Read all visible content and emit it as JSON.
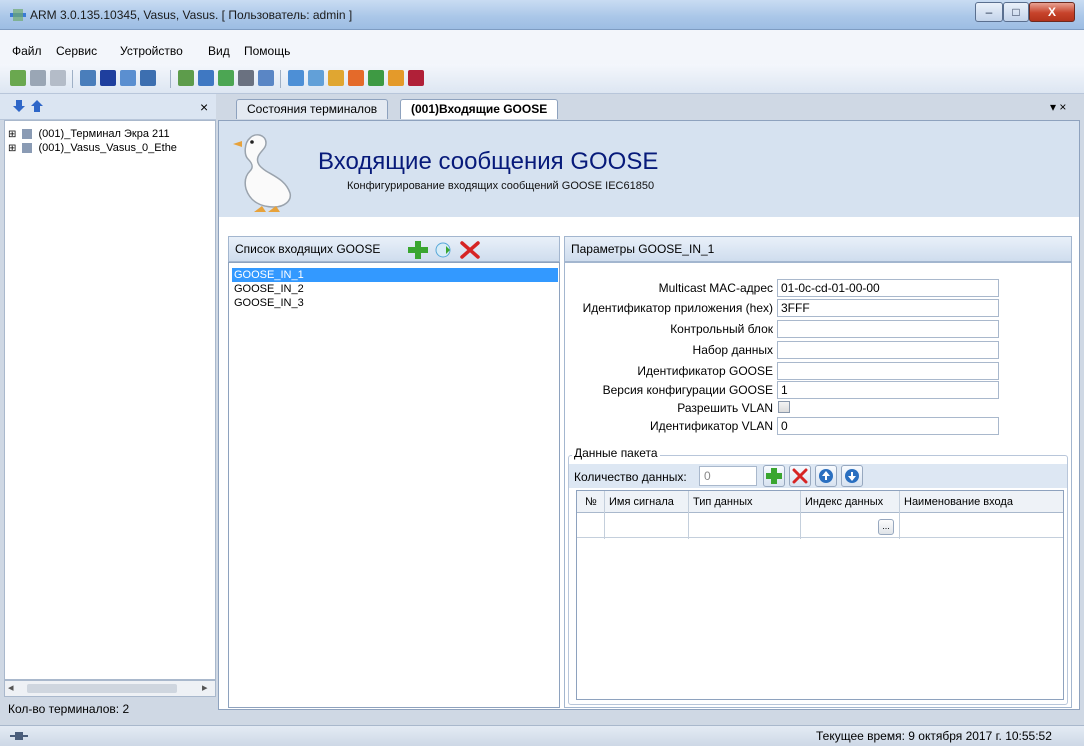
{
  "window": {
    "title": "ARM 3.0.135.10345, Vasus, Vasus. [ Пользователь: admin ]",
    "minimize": "–",
    "maximize": "□",
    "close": "X"
  },
  "menu": {
    "items": [
      "Файл",
      "Сервис",
      "Устройство",
      "Вид",
      "Помощь"
    ]
  },
  "left_panel": {
    "close": "×",
    "tree": [
      {
        "expander": "⊞",
        "label": "(001)_Терминал Экра 211"
      },
      {
        "expander": "⊞",
        "label": "(001)_Vasus_Vasus_0_Ethe"
      }
    ],
    "scroll_left": "◂",
    "scroll_right": "▸",
    "count_label": "Кол-во терминалов: 2"
  },
  "tabs": [
    {
      "label": "Состояния терминалов"
    },
    {
      "label": "(001)Входящие GOOSE"
    }
  ],
  "tab_menu": "▾ ×",
  "header": {
    "title": "Входящие сообщения GOOSE",
    "subtitle": "Конфигурирование входящих сообщений GOOSE IEC61850"
  },
  "list_panel": {
    "title": "Список входящих GOOSE",
    "items": [
      "GOOSE_IN_1",
      "GOOSE_IN_2",
      "GOOSE_IN_3"
    ],
    "selected_index": 0
  },
  "params_panel": {
    "title": "Параметры GOOSE_IN_1",
    "fields": [
      {
        "label": "Multicast MAC-адрес",
        "value": "01-0c-cd-01-00-00"
      },
      {
        "label": "Идентификатор приложения (hex)",
        "value": "3FFF"
      },
      {
        "label": "Контрольный блок",
        "value": ""
      },
      {
        "label": "Набор данных",
        "value": ""
      },
      {
        "label": "Идентификатор GOOSE",
        "value": ""
      },
      {
        "label": "Версия конфигурации GOOSE",
        "value": "1"
      }
    ],
    "vlan_enable_label": "Разрешить VLAN",
    "vlan_enabled": false,
    "vlan_id_label": "Идентификатор VLAN",
    "vlan_id_value": "0"
  },
  "packet": {
    "legend": "Данные пакета",
    "qty_label": "Количество данных:",
    "qty_value": "0",
    "columns": [
      "№",
      "Имя сигнала",
      "Тип данных",
      "Индекс данных",
      "Наименование входа"
    ],
    "ellipsis": "..."
  },
  "status": {
    "time": "Текущее время: 9 октября 2017 г. 10:55:52"
  },
  "colors": {
    "title_blue": "#071a7a",
    "selection": "#3399ff",
    "add_green": "#3aa630",
    "delete_red": "#d62424"
  }
}
